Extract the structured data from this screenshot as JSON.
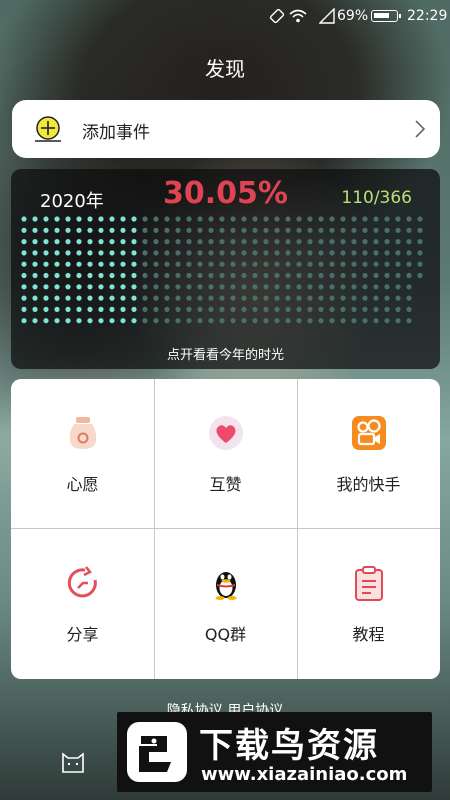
{
  "status_bar": {
    "battery_percent": "69%",
    "time": "22:29"
  },
  "header": {
    "title": "发现"
  },
  "add_event": {
    "label": "添加事件",
    "icon": "plus-circle-icon"
  },
  "year_progress": {
    "year": "2020年",
    "percent": "30.05%",
    "days": "110/366",
    "days_passed": 110,
    "days_total": 366,
    "hint": "点开看看今年的时光",
    "colors": {
      "percent": "#e04453",
      "days": "#b8e07a",
      "dot_passed": "#7fe3d6",
      "dot_remaining": "#4a6e6a"
    }
  },
  "features": [
    {
      "label": "心愿",
      "icon": "wish-jar-icon"
    },
    {
      "label": "互赞",
      "icon": "heart-icon"
    },
    {
      "label": "我的快手",
      "icon": "kuaishou-icon"
    },
    {
      "label": "分享",
      "icon": "share-icon"
    },
    {
      "label": "QQ群",
      "icon": "qq-penguin-icon"
    },
    {
      "label": "教程",
      "icon": "clipboard-icon"
    }
  ],
  "footer": {
    "links_text": "隐私协议  用户协议"
  },
  "watermark": {
    "title": "下载鸟资源",
    "url": "www.xiazainiao.com"
  }
}
